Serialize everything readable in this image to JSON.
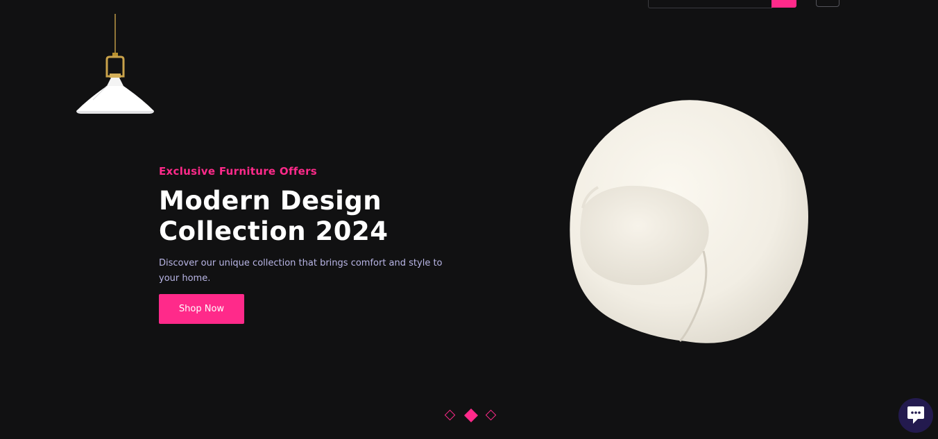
{
  "header": {
    "search": {
      "value": "",
      "placeholder": ""
    },
    "search_icon": "search-icon",
    "menu_icon": "menu-icon"
  },
  "hero": {
    "eyebrow": "Exclusive Furniture Offers",
    "headline_line1": "Modern Design",
    "headline_line2": "Collection 2024",
    "description": "Discover our unique collection that brings comfort and style to your home.",
    "cta_label": "Shop Now"
  },
  "slider": {
    "slide_count": 3,
    "active_index": 1
  },
  "chat": {
    "icon": "chat-icon"
  },
  "colors": {
    "background": "#111112",
    "accent": "#ff2a8a",
    "headline": "#ffffff",
    "description": "#b9b6e6",
    "chat_bubble": "#231a4e"
  }
}
